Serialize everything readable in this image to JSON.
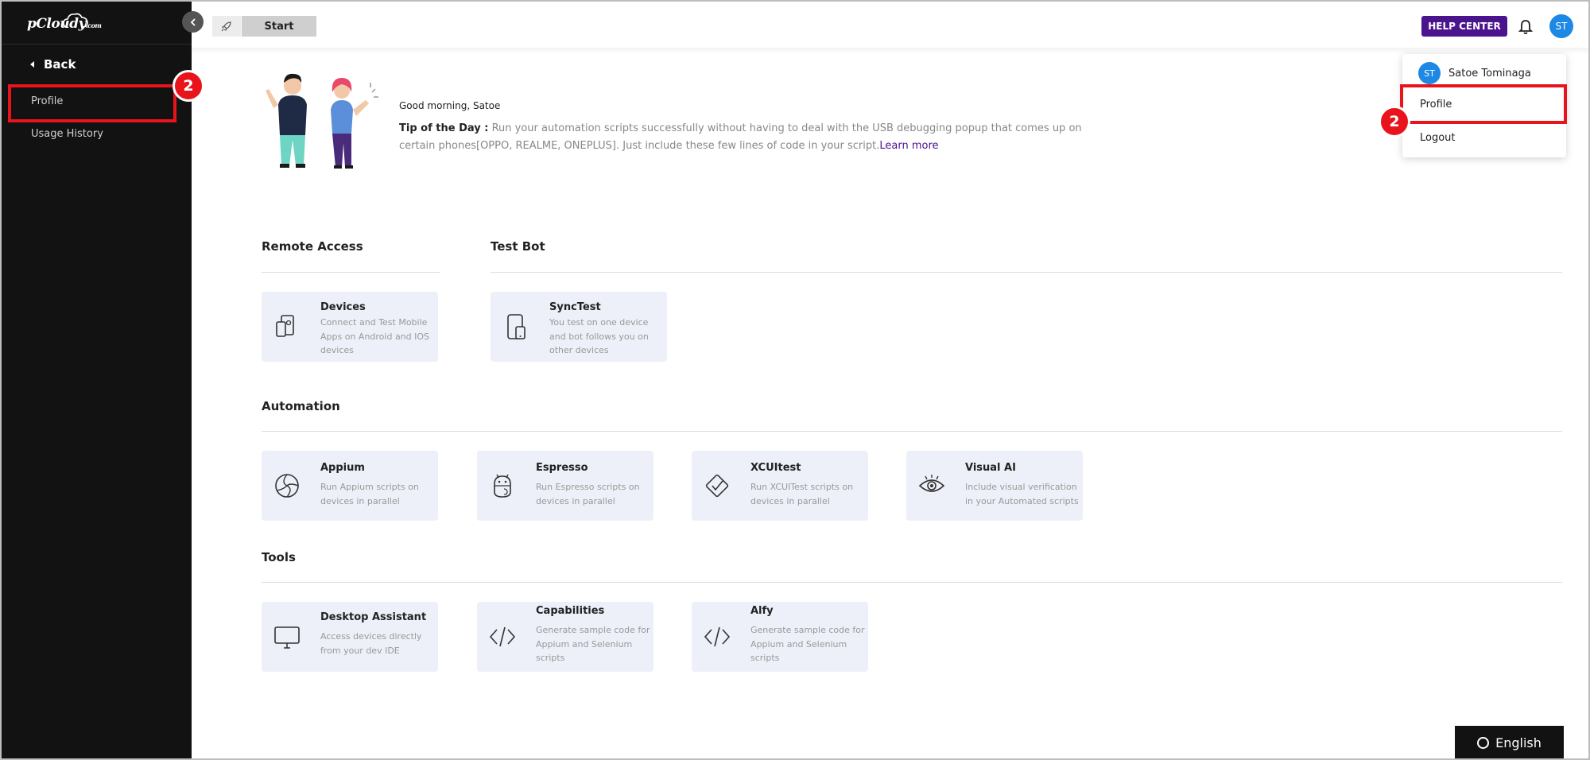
{
  "brand": {
    "logo_text": "pCloudy",
    "logo_suffix": ".com"
  },
  "sidebar": {
    "back_label": "Back",
    "items": [
      {
        "label": "Profile"
      },
      {
        "label": "Usage History"
      }
    ]
  },
  "topbar": {
    "start_label": "Start",
    "help_label": "HELP CENTER",
    "avatar_initials": "ST"
  },
  "dropdown": {
    "user_initials": "ST",
    "user_name": "Satoe Tominaga",
    "items": [
      {
        "label": "Profile"
      },
      {
        "label": "Logout"
      }
    ]
  },
  "annotations": {
    "step_badge": "2"
  },
  "greeting": {
    "text": "Good morning, Satoe",
    "tip_label": "Tip of the Day :",
    "tip_text": " Run your automation scripts successfully without having to deal with the USB debugging popup that comes up on certain phones[OPPO, REALME, ONEPLUS]. Just include these few lines of code in your script.",
    "learn_more": "Learn more"
  },
  "sections": {
    "remote_access": {
      "title": "Remote Access",
      "cards": [
        {
          "title": "Devices",
          "desc": "Connect and Test Mobile Apps on Android and IOS devices"
        }
      ]
    },
    "test_bot": {
      "title": "Test Bot",
      "cards": [
        {
          "title": "SyncTest",
          "desc": "You test on one device and bot follows you on other devices"
        }
      ]
    },
    "automation": {
      "title": "Automation",
      "cards": [
        {
          "title": "Appium",
          "desc": "Run Appium scripts on devices in parallel"
        },
        {
          "title": "Espresso",
          "desc": "Run Espresso scripts on devices in parallel"
        },
        {
          "title": "XCUItest",
          "desc": "Run XCUITest scripts on devices in parallel"
        },
        {
          "title": "Visual AI",
          "desc": "Include visual verification in your Automated scripts"
        }
      ]
    },
    "tools": {
      "title": "Tools",
      "cards": [
        {
          "title": "Desktop Assistant",
          "desc": "Access devices directly from your dev IDE"
        },
        {
          "title": "Capabilities",
          "desc": "Generate sample code for Appium and Selenium scripts"
        },
        {
          "title": "Alfy",
          "desc": "Generate sample code for Appium and Selenium scripts"
        }
      ]
    }
  },
  "language": {
    "label": "English"
  },
  "colors": {
    "sidebar": "#121212",
    "accent": "#4a148c",
    "card": "#edf0f8",
    "highlight": "#e8131b",
    "avatar": "#1e88e5"
  }
}
